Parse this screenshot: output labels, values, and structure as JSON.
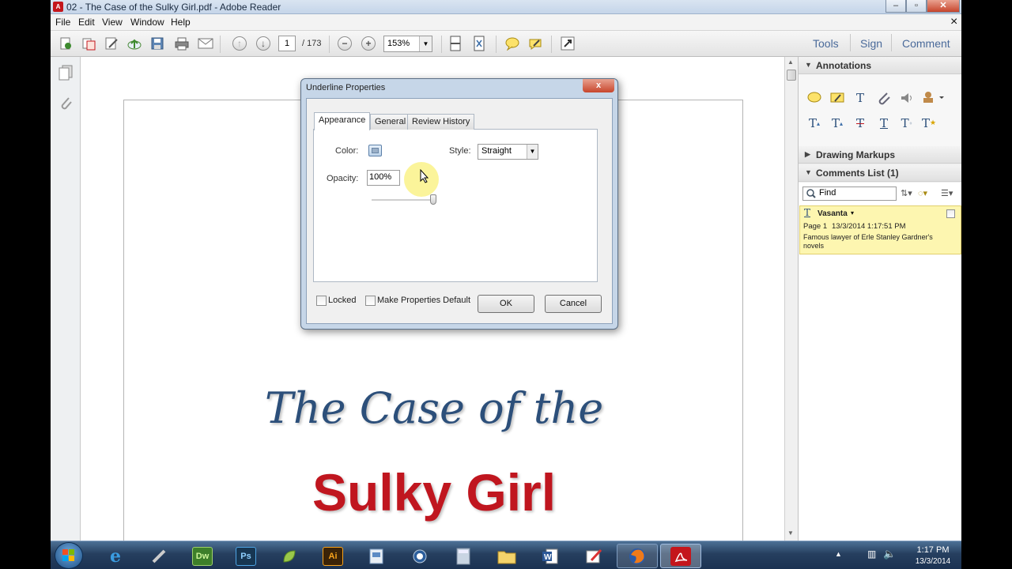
{
  "window": {
    "title": "02 - The Case of the Sulky Girl.pdf - Adobe Reader",
    "minimize": "–",
    "restore": "▫",
    "close": "✕"
  },
  "menubar": {
    "items": [
      "File",
      "Edit",
      "View",
      "Window",
      "Help"
    ],
    "close_glyph": "×"
  },
  "toolbar": {
    "page_current": "1",
    "page_total": "/ 173",
    "zoom": "153%",
    "zoom_out": "−",
    "zoom_in": "+",
    "right_tabs": [
      "Tools",
      "Sign",
      "Comment"
    ]
  },
  "right_panel": {
    "annotations": "Annotations",
    "drawing_markups": "Drawing Markups",
    "comments_list": "Comments List (1)",
    "find_placeholder": "Find",
    "comment": {
      "author": "Vasanta",
      "page": "Page 1",
      "timestamp": "13/3/2014 1:17:51 PM",
      "text": "Famous lawyer of Erle Stanley Gardner's novels"
    }
  },
  "document": {
    "title_line1": "The Case of the",
    "title_line2": "Sulky Girl"
  },
  "dialog": {
    "title": "Underline Properties",
    "tabs": [
      "Appearance",
      "General",
      "Review History"
    ],
    "color_label": "Color:",
    "style_label": "Style:",
    "style_value": "Straight",
    "opacity_label": "Opacity:",
    "opacity_value": "100%",
    "opacity_level": 1.0,
    "locked_label": "Locked",
    "default_label": "Make Properties Default",
    "ok": "OK",
    "cancel": "Cancel",
    "close_glyph": "x"
  },
  "taskbar": {
    "time": "1:17 PM",
    "date": "13/3/2014",
    "apps": [
      "Dw",
      "Ps",
      "Ai"
    ]
  },
  "colors": {
    "title_blue": "#2c4f7a",
    "title_red": "#c0161f",
    "comment_bg": "#fdf6b0",
    "accent": "#4a6a9a"
  }
}
